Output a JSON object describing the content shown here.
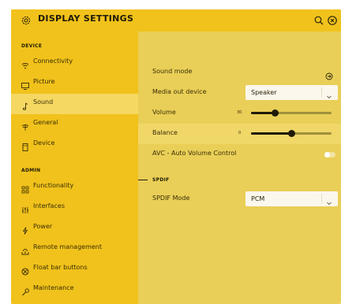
{
  "window": {
    "title": "DISPLAY SETTINGS",
    "title_icon": "gear-icon",
    "actions": [
      "search-icon",
      "close-icon"
    ]
  },
  "sidebar": {
    "sections": [
      {
        "label": "DEVICE",
        "items": [
          {
            "label": "Connectivity",
            "icon": "wifi-icon",
            "active": false
          },
          {
            "label": "Picture",
            "icon": "monitor-icon",
            "active": false
          },
          {
            "label": "Sound",
            "icon": "music-note-icon",
            "active": true
          },
          {
            "label": "General",
            "icon": "antenna-icon",
            "active": false
          },
          {
            "label": "Device",
            "icon": "device-icon",
            "active": false
          }
        ]
      },
      {
        "label": "ADMIN",
        "items": [
          {
            "label": "Functionality",
            "icon": "grid-icon",
            "active": false
          },
          {
            "label": "Interfaces",
            "icon": "sliders-icon",
            "active": false
          },
          {
            "label": "Power",
            "icon": "power-bolt-icon",
            "active": false
          },
          {
            "label": "Remote management",
            "icon": "remote-icon",
            "active": false
          },
          {
            "label": "Float bar buttons",
            "icon": "float-bar-icon",
            "active": false
          },
          {
            "label": "Maintenance",
            "icon": "wrench-icon",
            "active": false
          }
        ]
      }
    ]
  },
  "settings": {
    "sound_mode": {
      "label": "Sound mode",
      "icon": "arrow-right-circle-icon"
    },
    "media_out_device": {
      "label": "Media out device",
      "value": "Speaker"
    },
    "volume": {
      "label": "Volume",
      "value_text": "30",
      "value": 30,
      "max": 100
    },
    "balance": {
      "label": "Balance",
      "value_text": "0",
      "value": 0,
      "min": -50,
      "max": 50
    },
    "avc": {
      "label": "AVC - Auto Volume Control",
      "enabled": false
    },
    "spdif_section": {
      "label": "SPDIF"
    },
    "spdif_mode": {
      "label": "SPDIF Mode",
      "value": "PCM"
    }
  },
  "colors": {
    "sidebar": "#f1c21b",
    "content": "#e9cf57",
    "active_item": "#f5d862",
    "text_dark": "#1f1a08"
  }
}
